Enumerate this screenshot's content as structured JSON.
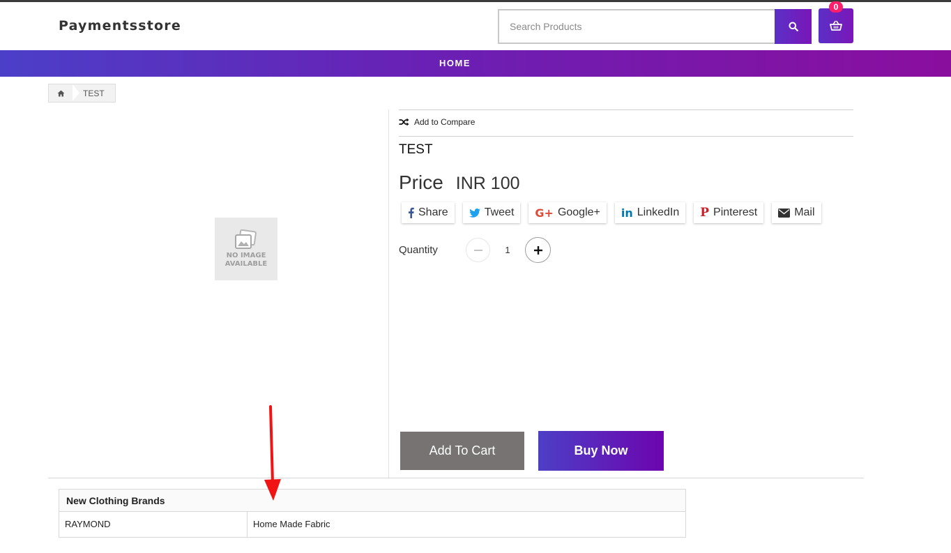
{
  "site": {
    "name": "Paymentsstore"
  },
  "search": {
    "placeholder": "Search Products"
  },
  "cart": {
    "count": "0"
  },
  "nav": {
    "home": "HOME"
  },
  "breadcrumb": {
    "current": "TEST"
  },
  "product_image": {
    "line1": "NO IMAGE",
    "line2": "AVAILABLE"
  },
  "product": {
    "compare_label": "Add to Compare",
    "title": "TEST",
    "price_label": "Price",
    "price_value": "INR 100",
    "quantity_label": "Quantity",
    "quantity": "1",
    "add_to_cart": "Add To Cart",
    "buy_now": "Buy Now"
  },
  "share": {
    "buttons": [
      {
        "label": "Share",
        "icon": "facebook-icon",
        "color": "#3b5998"
      },
      {
        "label": "Tweet",
        "icon": "twitter-icon",
        "color": "#1da1f2"
      },
      {
        "label": "Google+",
        "icon": "google-plus-icon",
        "color": "#dd4b39"
      },
      {
        "label": "LinkedIn",
        "icon": "linkedin-icon",
        "color": "#0077b5"
      },
      {
        "label": "Pinterest",
        "icon": "pinterest-icon",
        "color": "#cb2027"
      },
      {
        "label": "Mail",
        "icon": "mail-icon",
        "color": "#333333"
      }
    ]
  },
  "specs": {
    "heading": "New Clothing Brands",
    "rows": [
      {
        "key": "RAYMOND",
        "value": "Home Made Fabric"
      }
    ]
  },
  "colors": {
    "accent_start": "#4b3fc8",
    "accent_end": "#8a0e9e",
    "badge": "#ff1f6a",
    "cart_button": "#767372"
  }
}
